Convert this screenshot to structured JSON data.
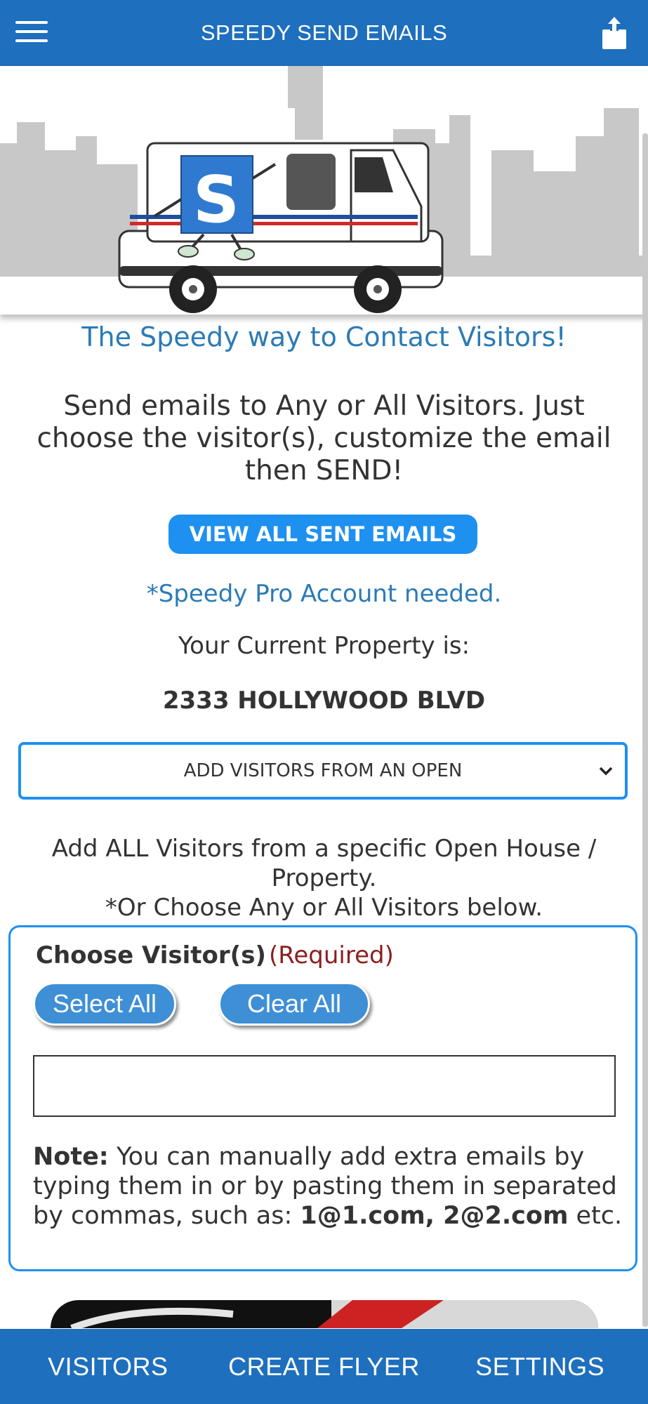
{
  "appbar": {
    "title": "SPEEDY SEND EMAILS",
    "menu_icon": "hamburger-menu-icon",
    "share_icon": "share-icon"
  },
  "hero": {
    "description_icon": "mail-truck-mascot"
  },
  "main": {
    "tagline": "The Speedy way to Contact Visitors!",
    "intro": "Send emails to Any or All Visitors. Just choose the visitor(s), customize the email then SEND!",
    "view_sent_label": "VIEW ALL SENT EMAILS",
    "pro_note": "*Speedy Pro Account needed.",
    "current_property_label": "Your Current Property is:",
    "property_name": "2333 HOLLYWOOD BLVD",
    "open_select_value": "ADD VISITORS FROM AN OPEN",
    "add_all_line1": "Add ALL Visitors from a specific Open House / Property.",
    "add_all_line2": "*Or Choose Any or All Visitors below."
  },
  "choose": {
    "label": "Choose Visitor(s)",
    "required": "(Required)",
    "select_all": "Select All",
    "clear_all": "Clear All",
    "input_value": "",
    "note_bold": "Note:",
    "note_text": " You can manually add extra emails by typing them in or by pasting them in separated by commas, such as: ",
    "note_example": "1@1.com, 2@2.com",
    "note_end": " etc."
  },
  "bottom_nav": {
    "items": [
      "VISITORS",
      "CREATE FLYER",
      "SETTINGS"
    ]
  },
  "colors": {
    "primary": "#1e6fbd",
    "accent": "#1e90f0",
    "tagline": "#2b7bb6",
    "required": "#8b1f1f"
  }
}
